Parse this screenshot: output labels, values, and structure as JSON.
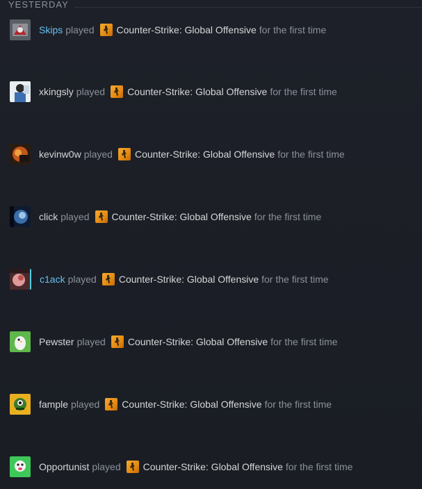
{
  "section": {
    "day_label": "YESTERDAY"
  },
  "verb": "played",
  "game": {
    "name": "Counter-Strike: Global Offensive",
    "icon": "csgo-game-icon"
  },
  "suffix": "for the first time",
  "colors": {
    "friend_name": "#66c0f4",
    "name": "#d6d7d8",
    "muted": "#8b929a",
    "game_icon": "#f4a930"
  },
  "entries": [
    {
      "username": "Skips",
      "friend": true
    },
    {
      "username": "xkingsly",
      "friend": false
    },
    {
      "username": "kevinw0w",
      "friend": false
    },
    {
      "username": "click",
      "friend": false
    },
    {
      "username": "c1ack",
      "friend": true
    },
    {
      "username": "Pewster",
      "friend": false
    },
    {
      "username": "fample",
      "friend": false
    },
    {
      "username": "Opportunist",
      "friend": false
    }
  ]
}
